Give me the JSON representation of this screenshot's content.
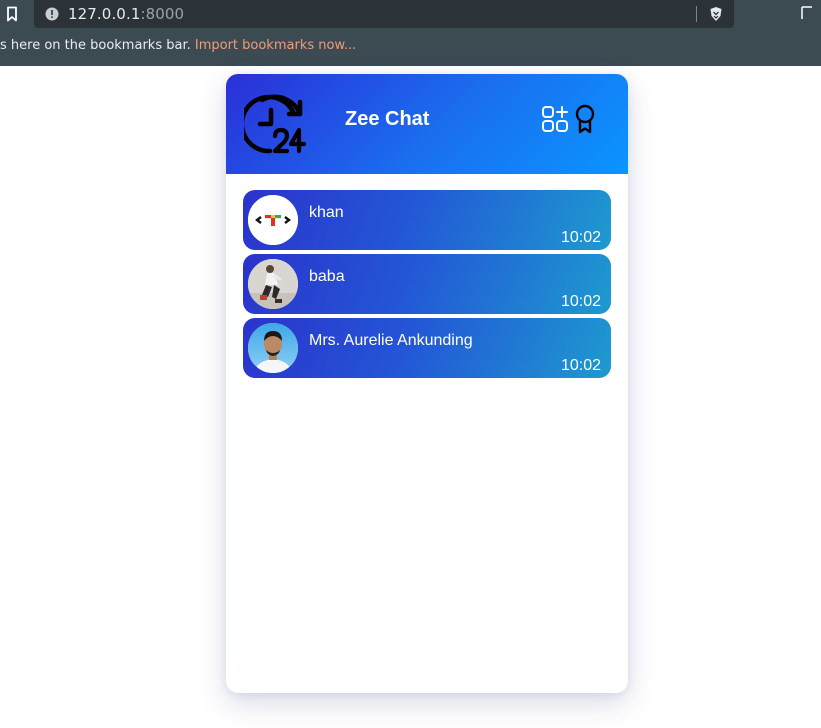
{
  "browser": {
    "url_host": "127.0.0.1",
    "url_port": ":8000",
    "bookmarks_text": "s here on the bookmarks bar.",
    "bookmarks_link": "Import bookmarks now..."
  },
  "app": {
    "title": "Zee Chat",
    "logo_icon": "clock-24-icon",
    "header_icons": [
      "apps-add-icon",
      "badge-icon"
    ],
    "colors": {
      "header_gradient_start": "#2b2fd8",
      "header_gradient_end": "#0a95ff",
      "item_gradient_start": "#2b33cc",
      "item_gradient_end": "#1e9ad0"
    }
  },
  "chats": [
    {
      "name": "khan",
      "time": "10:02",
      "avatar": "logo-avatar"
    },
    {
      "name": "baba",
      "time": "10:02",
      "avatar": "person-photo-avatar"
    },
    {
      "name": "Mrs. Aurelie Ankunding",
      "time": "10:02",
      "avatar": "person-photo-avatar"
    }
  ]
}
